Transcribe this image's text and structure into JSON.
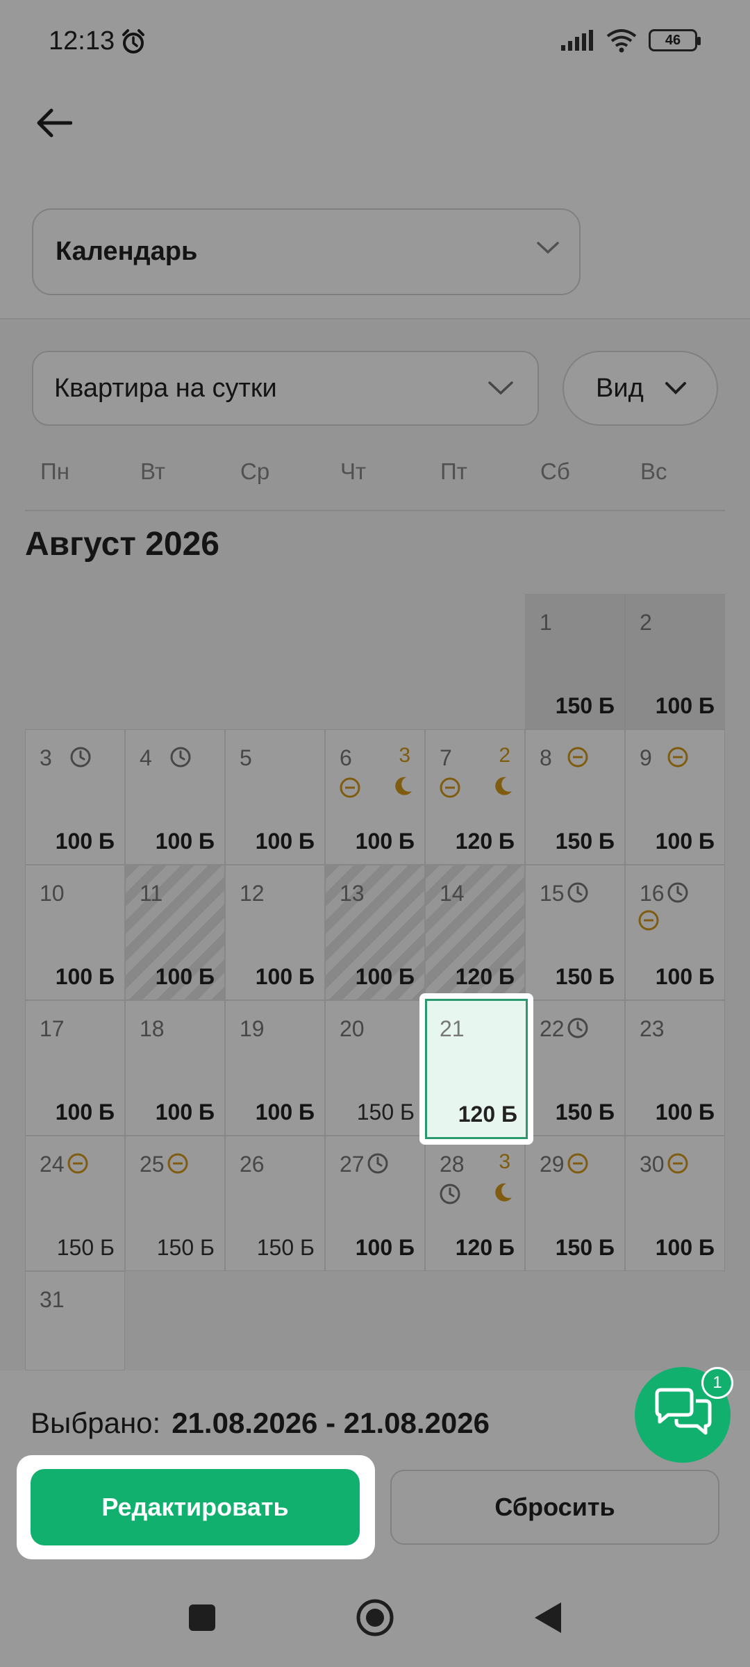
{
  "status_bar": {
    "time": "12:13",
    "battery": "46"
  },
  "calendar_select": {
    "label": "Календарь"
  },
  "property_select": {
    "label": "Квартира на сутки"
  },
  "view_button": {
    "label": "Вид"
  },
  "weekdays": [
    "Пн",
    "Вт",
    "Ср",
    "Чт",
    "Пт",
    "Сб",
    "Вс"
  ],
  "month_title": "Август 2026",
  "days": [
    {
      "day": "1",
      "price": "150 Б"
    },
    {
      "day": "2",
      "price": "100 Б"
    },
    {
      "day": "3",
      "price": "100 Б"
    },
    {
      "day": "4",
      "price": "100 Б"
    },
    {
      "day": "5",
      "price": "100 Б"
    },
    {
      "day": "6",
      "price": "100 Б",
      "count": "3"
    },
    {
      "day": "7",
      "price": "120 Б",
      "count": "2"
    },
    {
      "day": "8",
      "price": "150 Б"
    },
    {
      "day": "9",
      "price": "100 Б"
    },
    {
      "day": "10",
      "price": "100 Б"
    },
    {
      "day": "11",
      "price": "100 Б"
    },
    {
      "day": "12",
      "price": "100 Б"
    },
    {
      "day": "13",
      "price": "100 Б"
    },
    {
      "day": "14",
      "price": "120 Б"
    },
    {
      "day": "15",
      "price": "150 Б"
    },
    {
      "day": "16",
      "price": "100 Б"
    },
    {
      "day": "17",
      "price": "100 Б"
    },
    {
      "day": "18",
      "price": "100 Б"
    },
    {
      "day": "19",
      "price": "100 Б"
    },
    {
      "day": "20",
      "price": "150 Б"
    },
    {
      "day": "21",
      "price": "120 Б"
    },
    {
      "day": "22",
      "price": "150 Б"
    },
    {
      "day": "23",
      "price": "100 Б"
    },
    {
      "day": "24",
      "price": "150 Б"
    },
    {
      "day": "25",
      "price": "150 Б"
    },
    {
      "day": "26",
      "price": "150 Б"
    },
    {
      "day": "27",
      "price": "100 Б"
    },
    {
      "day": "28",
      "price": "120 Б",
      "count": "3"
    },
    {
      "day": "29",
      "price": "150 Б"
    },
    {
      "day": "30",
      "price": "100 Б"
    },
    {
      "day": "31",
      "price": ""
    }
  ],
  "selection": {
    "label": "Выбрано:",
    "dates": "21.08.2026 - 21.08.2026"
  },
  "buttons": {
    "edit": "Редактировать",
    "reset": "Сбросить"
  },
  "chat": {
    "badge": "1"
  },
  "colors": {
    "accent": "#12b06f",
    "selected_border": "#2a9a6e",
    "status_icon": "#d49a1a"
  }
}
